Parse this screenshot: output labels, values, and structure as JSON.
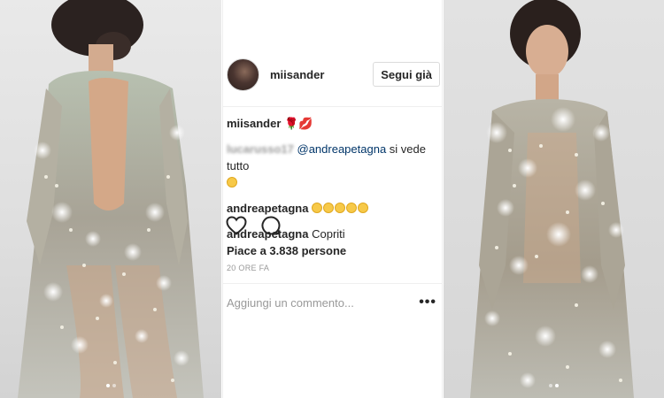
{
  "post": {
    "header": {
      "username": "miisander",
      "follow_label": "Segui già"
    },
    "caption": {
      "username": "miisander",
      "text": "🌹💋"
    },
    "comments": [
      {
        "username": "lucarusso17",
        "mention": "@andreapetagna",
        "text": " si vede tutto"
      },
      {
        "username": "andreapetagna",
        "text": ""
      },
      {
        "username": "andreapetagna",
        "text": " Copriti"
      }
    ],
    "likes": "Piace a 3.838 persone",
    "timestamp": "20 ORE FA",
    "add_comment": {
      "placeholder": "Aggiungi un commento..."
    }
  },
  "icons": {
    "like": "heart-icon",
    "comment": "speech-bubble-icon",
    "more": "more-options-icon",
    "smiley": "smiley-emoji"
  },
  "colors": {
    "text": "#262626",
    "secondary": "#999999",
    "mention": "#003569",
    "border": "#dbdbdb",
    "emoji": "#f7c948"
  }
}
